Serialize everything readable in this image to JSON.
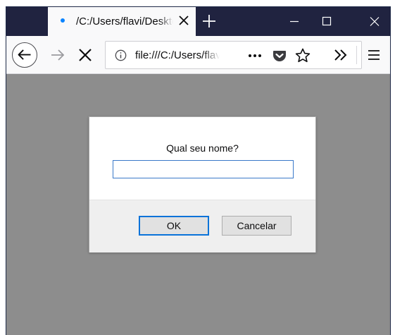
{
  "browser": {
    "tab": {
      "title": "/C:/Users/flavi/Desktop"
    },
    "url": {
      "text": "file:///C:/Users/flavi/Desktop"
    },
    "colors": {
      "titlebar": "#202340",
      "tab_dot": "#0a84ff",
      "content_bg": "#8d8d8d"
    }
  },
  "dialog": {
    "message": "Qual seu nome?",
    "input_value": "",
    "ok_label": "OK",
    "cancel_label": "Cancelar",
    "colors": {
      "focus_border": "#0a73d9"
    }
  },
  "icons": {
    "tab_close": "close-icon",
    "new_tab": "plus-icon",
    "minimize": "minimize-icon",
    "maximize": "maximize-icon",
    "window_close": "close-icon",
    "back": "back-arrow-icon",
    "forward": "forward-arrow-icon",
    "stop": "stop-icon",
    "site_info": "info-icon",
    "page_actions": "ellipsis-icon",
    "pocket": "pocket-icon",
    "bookmark": "star-icon",
    "overflow": "double-chevron-icon",
    "menu": "hamburger-menu-icon"
  }
}
